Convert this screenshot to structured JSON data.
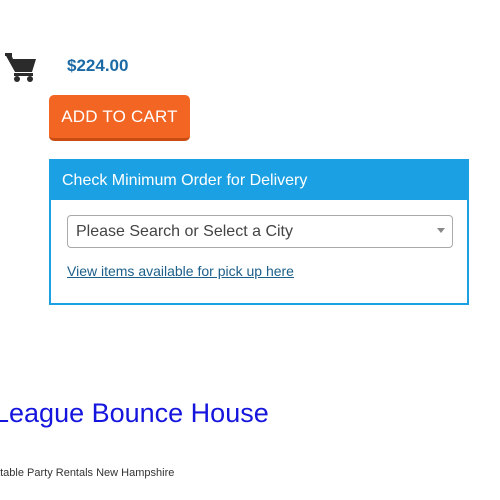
{
  "product": {
    "price": "$224.00",
    "add_to_cart_label": "ADD TO CART",
    "title": "League Bounce House",
    "category": "atable Party Rentals New Hampshire"
  },
  "delivery": {
    "header": "Check Minimum Order for Delivery",
    "city_select_placeholder": "Please Search or Select a City",
    "pickup_link": "View items available for pick up here"
  },
  "icons": {
    "cart": "shopping-cart-icon",
    "dropdown": "caret-down-icon"
  },
  "colors": {
    "price": "#1b6aa5",
    "add_to_cart_button": "#f26522",
    "delivery_accent": "#1aa0e3",
    "title_link": "#1515dd"
  }
}
